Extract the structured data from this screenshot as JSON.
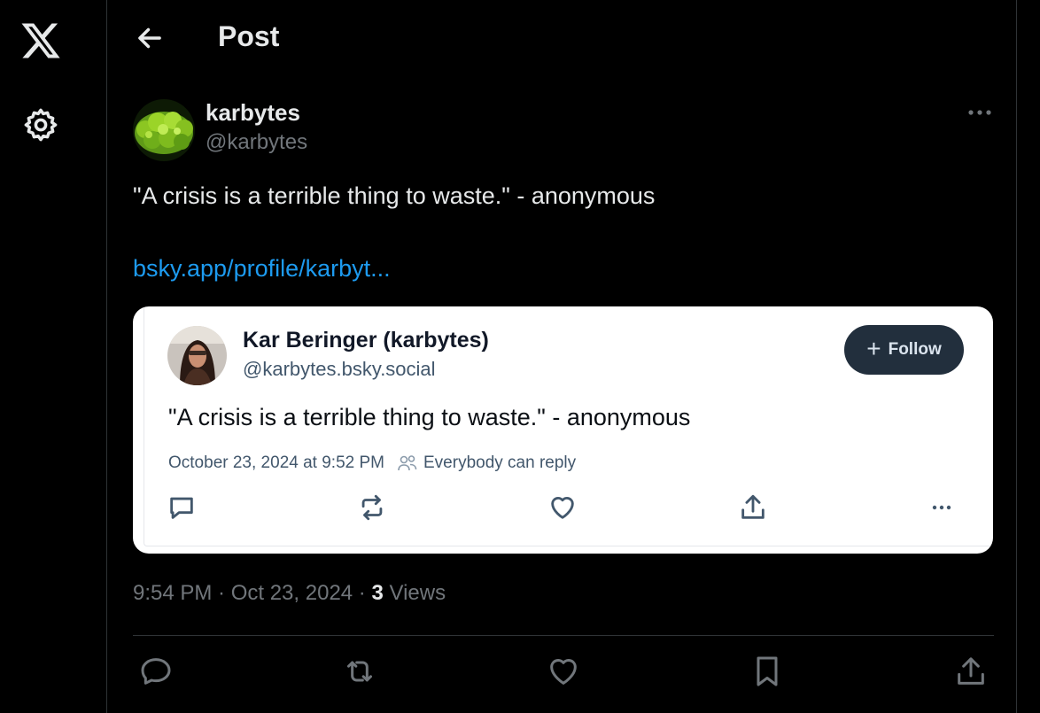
{
  "nav": {
    "logo": "x-logo-icon",
    "settings": "gear-icon"
  },
  "header": {
    "back": "arrow-left-icon",
    "title": "Post"
  },
  "post": {
    "author_name": "karbytes",
    "author_handle": "@karbytes",
    "text": "\"A crisis is a terrible thing to waste.\" - anonymous",
    "link": "bsky.app/profile/karbyt...",
    "timestamp": "9:54 PM · Oct 23, 2024 · ",
    "views_count": "3",
    "views_label": " Views"
  },
  "embed": {
    "name": "Kar Beringer (karbytes)",
    "handle": "@karbytes.bsky.social",
    "follow_label": "Follow",
    "text": "\"A crisis is a terrible thing to waste.\" - anonymous",
    "date": "October 23, 2024 at 9:52 PM",
    "reply_setting": "Everybody can reply"
  },
  "colors": {
    "link": "#1d9bf0",
    "muted": "#71767b",
    "follow_bg": "#222f3d"
  }
}
